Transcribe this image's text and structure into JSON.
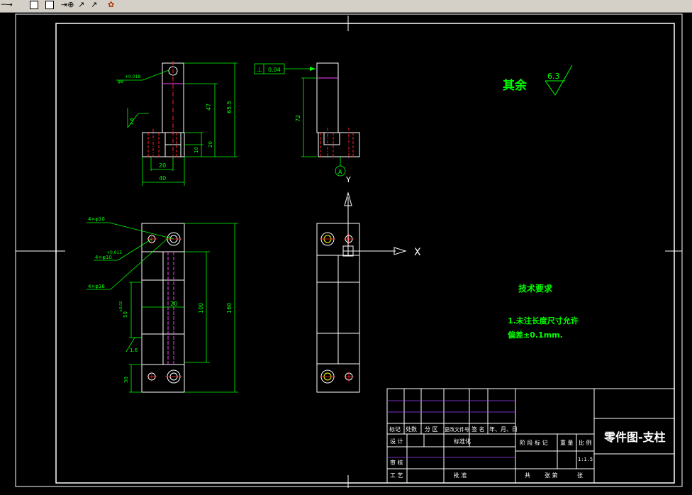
{
  "toolbar": {
    "icons": [
      "line-arrow-icon",
      "rectangle-icon",
      "square-icon",
      "dimension-icon",
      "leader-icon",
      "paint-icon"
    ]
  },
  "drawing": {
    "roughness": {
      "rest_label": "其余",
      "rest_value": "6.3",
      "front_value": "1.6",
      "bottom_value": "1.6"
    },
    "tolerance_frame": {
      "symbol": "⊥",
      "value": "0.04",
      "datum": "A"
    },
    "datum_label": "A",
    "ucs": {
      "x": "X",
      "y": "Y"
    },
    "dims": {
      "front_hole": "φ8",
      "front_hole_tol": "+0.018",
      "front_47": "47",
      "front_65": "65.5",
      "front_10": "10",
      "front_20h": "20",
      "front_20w": "20",
      "front_40": "40",
      "side_72": "72",
      "top_hole1": "4×φ10",
      "top_hole2": "4×φ10",
      "top_hole2_tol": "+0.015",
      "top_hole3": "4×φ16",
      "top_50": "50",
      "top_50_tol": "±0.02",
      "top_20": "20",
      "top_100": "100",
      "top_160": "160",
      "top_30": "30"
    },
    "notes": {
      "title": "技术要求",
      "line1": "1.未注长度尺寸允许",
      "line2": "偏差±0.1mm."
    },
    "title_block": {
      "drawing_name": "零件图-支柱",
      "row_labels": [
        "标记",
        "处数",
        "分 区",
        "更改文件号",
        "签 名",
        "年、月、日"
      ],
      "design": "设 计",
      "standard": "标准化",
      "stage": "阶 段 标 记",
      "weight": "重 量",
      "ratio": "比 例",
      "scale": "1:1.5",
      "review": "审 核",
      "process": "工 艺",
      "approve": "批 准",
      "total": "共",
      "sheet": "张 第",
      "sheet2": "张"
    }
  }
}
